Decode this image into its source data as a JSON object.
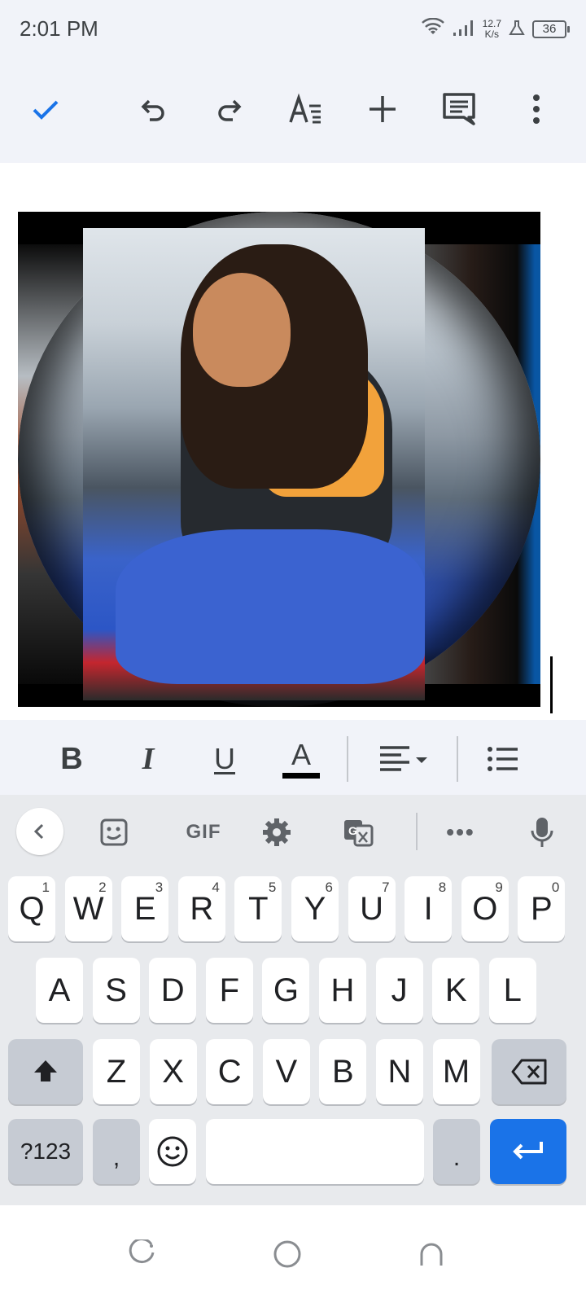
{
  "status_bar": {
    "time": "2:01 PM",
    "net_speed_value": "12.7",
    "net_speed_unit": "K/s",
    "battery_level": "36",
    "icons": [
      "wifi-icon",
      "signal-icon",
      "alert-icon",
      "battery-icon"
    ]
  },
  "toolbar": {
    "icons": [
      "check-icon",
      "undo-icon",
      "redo-icon",
      "text-format-icon",
      "add-icon",
      "comment-icon",
      "more-vert-icon"
    ]
  },
  "document": {
    "content": "image",
    "cursor_visible": true
  },
  "format_bar": {
    "bold_label": "B",
    "italic_label": "I",
    "underline_label": "U",
    "text_color_label": "A",
    "text_color": "#000000",
    "icons": [
      "bold-icon",
      "italic-icon",
      "underline-icon",
      "text-color-icon",
      "align-left-icon",
      "dropdown-icon",
      "bulleted-list-icon"
    ]
  },
  "keyboard": {
    "toolbar": {
      "gif_label": "GIF",
      "more_label": "•••",
      "icons": [
        "back-icon",
        "sticker-icon",
        "gear-icon",
        "translate-icon",
        "mic-icon"
      ]
    },
    "row1": [
      {
        "label": "Q",
        "hint": "1"
      },
      {
        "label": "W",
        "hint": "2"
      },
      {
        "label": "E",
        "hint": "3"
      },
      {
        "label": "R",
        "hint": "4"
      },
      {
        "label": "T",
        "hint": "5"
      },
      {
        "label": "Y",
        "hint": "6"
      },
      {
        "label": "U",
        "hint": "7"
      },
      {
        "label": "I",
        "hint": "8"
      },
      {
        "label": "O",
        "hint": "9"
      },
      {
        "label": "P",
        "hint": "0"
      }
    ],
    "row2": [
      "A",
      "S",
      "D",
      "F",
      "G",
      "H",
      "J",
      "K",
      "L"
    ],
    "row3": [
      "Z",
      "X",
      "C",
      "V",
      "B",
      "N",
      "M"
    ],
    "row4": {
      "symbols_label": "?123",
      "comma_label": ",",
      "period_label": "."
    },
    "accent_color": "#1a73e8"
  },
  "nav_bar": {
    "icons": [
      "recents-icon",
      "home-icon",
      "back-nav-icon"
    ]
  }
}
